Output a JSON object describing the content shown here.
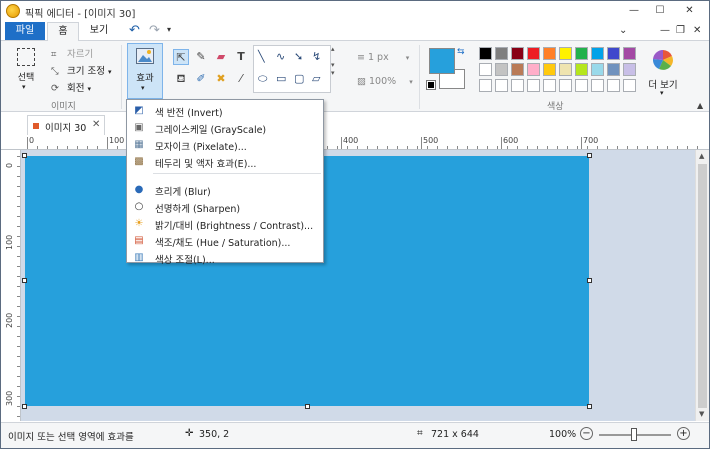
{
  "window": {
    "title": "픽픽 에디터 - [이미지 30]",
    "minimize": "—",
    "maximize": "☐",
    "close": "✕"
  },
  "ribbon_tabs": {
    "file": "파일",
    "home": "홈",
    "view": "보기"
  },
  "quick_access": {
    "undo": "↶",
    "redo": "↷",
    "dropdown": "▾"
  },
  "title_right_icons": [
    "⌄",
    "?",
    "—",
    "❐",
    "✕"
  ],
  "ribbon": {
    "select_label": "선택",
    "image_group_label": "이미지",
    "image_cmds": {
      "crop": "자르기",
      "resize": "크기 조정",
      "rotate": "회전"
    },
    "effects_label": "효과",
    "thickness": "1 px",
    "zoom": "100%",
    "color_group_label": "색상",
    "more_label": "더 보기",
    "palette": [
      "#000000",
      "#7f7f7f",
      "#880015",
      "#ed1c24",
      "#ff7f27",
      "#fff200",
      "#22b14c",
      "#00a2e8",
      "#3f48cc",
      "#a349a4",
      "#ffffff",
      "#c3c3c3",
      "#b97a57",
      "#ffaec9",
      "#ffc90e",
      "#efe4b0",
      "#b5e61d",
      "#99d9ea",
      "#7092be",
      "#c8bfe7",
      "#ffffff",
      "#ffffff",
      "#ffffff",
      "#ffffff",
      "#ffffff",
      "#ffffff",
      "#ffffff",
      "#ffffff",
      "#ffffff",
      "#ffffff"
    ],
    "primary_color": "#26a0dc",
    "secondary_color": "#ffffff"
  },
  "document_tab": {
    "title": "이미지 30",
    "close": "✕"
  },
  "ruler": {
    "top_ticks": [
      "0",
      "100",
      "400",
      "500",
      "600",
      "700"
    ],
    "left_ticks": [
      "0",
      "100",
      "200",
      "300"
    ]
  },
  "effects_menu": [
    {
      "label": "색 반전 (Invert)",
      "icon": "invert-icon"
    },
    {
      "label": "그레이스케일 (GrayScale)",
      "icon": "grayscale-icon"
    },
    {
      "label": "모자이크 (Pixelate)...",
      "icon": "pixelate-icon"
    },
    {
      "label": "테두리 및 액자 효과(E)...",
      "icon": "frame-icon"
    },
    {
      "label": "흐리게 (Blur)",
      "icon": "blur-drop-icon"
    },
    {
      "label": "선명하게 (Sharpen)",
      "icon": "sharpen-drop-icon"
    },
    {
      "label": "밝기/대비 (Brightness / Contrast)...",
      "icon": "brightness-icon"
    },
    {
      "label": "색조/채도 (Hue / Saturation)...",
      "icon": "hue-icon"
    },
    {
      "label": "색상 조절(L)...",
      "icon": "color-adjust-icon"
    }
  ],
  "canvas": {
    "fill_color": "#26a0dc",
    "workspace_color": "#d0dae8"
  },
  "status": {
    "hint": "이미지 또는 선택 영역에 효과를",
    "position": "350, 2",
    "size": "721 x 644",
    "zoom": "100%",
    "zoom_out": "−",
    "zoom_in": "+"
  }
}
